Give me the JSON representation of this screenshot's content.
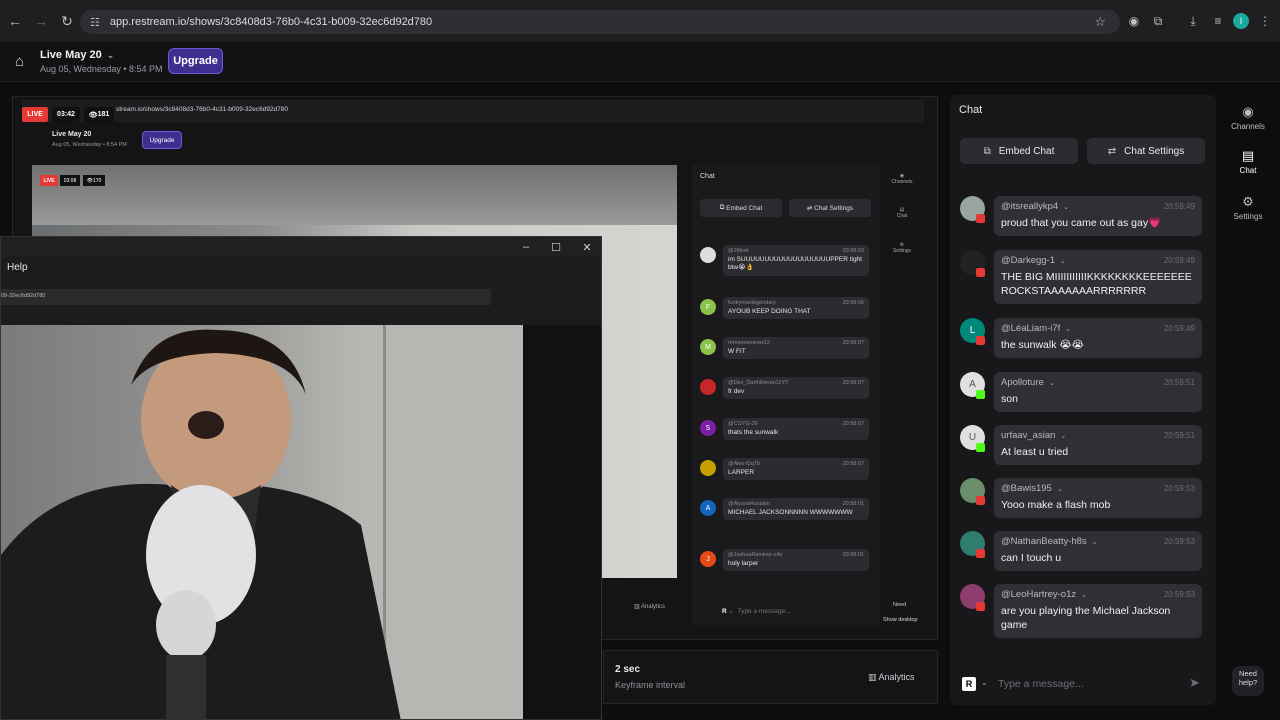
{
  "browser": {
    "url": "app.restream.io/shows/3c8408d3-76b0-4c31-b009-32ec6d92d780"
  },
  "header": {
    "show_title": "Live May 20",
    "show_subtitle": "Aug 05, Wednesday • 8:54 PM",
    "upgrade_label": "Upgrade"
  },
  "nested": {
    "live": "LIVE",
    "timer": "03:42",
    "viewers": "181",
    "url": "stream.io/shows/3c8408d3-76b0-4c31-b009-32ec6d92d780",
    "show_title": "Live May 20",
    "show_subtitle": "Aug 05, Wednesday • 8:54 PM",
    "upgrade": "Upgrade",
    "inner_live": "LIVE",
    "inner_timer": "03:08",
    "inner_viewers": "170",
    "chat_title": "Chat",
    "embed_chat": "Embed Chat",
    "chat_settings": "Chat Settings",
    "rail": [
      "Channels",
      "Chat",
      "Settings"
    ],
    "analytics": "Analytics",
    "input_placeholder": "Type a message...",
    "need": "Need",
    "show_desktop": "Show desktop",
    "messages": [
      {
        "user": "@2tfleet",
        "time": "20:58:03",
        "text": "im SUUUUUUUUUUUUUUUUUUUPPER tight btw😭👌",
        "color": "#ddd"
      },
      {
        "user": "funkymanlegendary",
        "time": "20:58:06",
        "text": "AYOUB KEEP DOING THAT",
        "color": "#8bc34a",
        "initial": "F"
      },
      {
        "user": "mrmeowmeow12",
        "time": "20:58:07",
        "text": "W FIT",
        "color": "#8bc34a",
        "initial": "M"
      },
      {
        "user": "@Dev_DarthRevan11YT",
        "time": "20:58:07",
        "text": "fr dev",
        "color": "#c62828"
      },
      {
        "user": "@COYG-26",
        "time": "20:58:07",
        "text": "thats the sunwalk",
        "color": "#7b1fa2",
        "initial": "S"
      },
      {
        "user": "@Alex-f2q7b",
        "time": "20:58:07",
        "text": "LARPER",
        "color": "#c8a000"
      },
      {
        "user": "@AlyssaHussain",
        "time": "20:58:01",
        "text": "MICHAEL JACKSONNNNN WWWWWWW",
        "color": "#1565c0",
        "initial": "A"
      },
      {
        "user": "@JoshuaRamirez-c4o",
        "time": "20:58:01",
        "text": "holy larper",
        "color": "#e64a19",
        "initial": "J"
      }
    ]
  },
  "camera_window": {
    "menu_help": "Help",
    "url_fragment": "09-32ec6d92d780"
  },
  "stage_bottom": {
    "keyframe_value": "2 sec",
    "keyframe_label": "Keyframe interval",
    "analytics_label": "Analytics"
  },
  "chat": {
    "title": "Chat",
    "embed_label": "Embed Chat",
    "settings_label": "Chat Settings",
    "input_placeholder": "Type a message...",
    "messages": [
      {
        "user": "@itsreallykp4",
        "time": "20:59:49",
        "text": "proud that you came out as gay💗",
        "platform": "youtube",
        "avatar_color": "#9aa5a0",
        "initial": ""
      },
      {
        "user": "@Darkegg-1",
        "time": "20:59:49",
        "text": "THE BIG MIIIIIIIIIIIKKKKKKKKEEEEEEE ROCKSTAAAAAAARRRRRRR",
        "platform": "youtube",
        "avatar_color": "#222",
        "initial": ""
      },
      {
        "user": "@LéaLiam-i7f",
        "time": "20:59:49",
        "text": "the sunwalk 😭😭",
        "platform": "youtube",
        "avatar_color": "#00897b",
        "initial": "L"
      },
      {
        "user": "Apolloture",
        "time": "20:59:51",
        "text": "son",
        "platform": "kick",
        "avatar_color": "#e0e0e0",
        "initial": "A"
      },
      {
        "user": "urfaav_asian",
        "time": "20:59:51",
        "text": "At least u tried",
        "platform": "kick",
        "avatar_color": "#e0e0e0",
        "initial": "U"
      },
      {
        "user": "@Bawis195",
        "time": "20:59:53",
        "text": "Yooo make a flash mob",
        "platform": "youtube",
        "avatar_color": "#6b8e6b",
        "initial": ""
      },
      {
        "user": "@NathanBeatty-h8s",
        "time": "20:59:53",
        "text": "can I touch u",
        "platform": "youtube",
        "avatar_color": "#2e7d6e",
        "initial": ""
      },
      {
        "user": "@LeoHartrey-o1z",
        "time": "20:59:53",
        "text": "are you playing the Michael Jackson game",
        "platform": "youtube",
        "avatar_color": "#8e3b6e",
        "initial": ""
      }
    ]
  },
  "rail": {
    "channels": "Channels",
    "chat": "Chat",
    "settings": "Settings",
    "need_help": "Need help?"
  },
  "colors": {
    "accent": "#6a5bd6",
    "live": "#e53935",
    "youtube": "#e53935",
    "kick": "#53fc18"
  }
}
